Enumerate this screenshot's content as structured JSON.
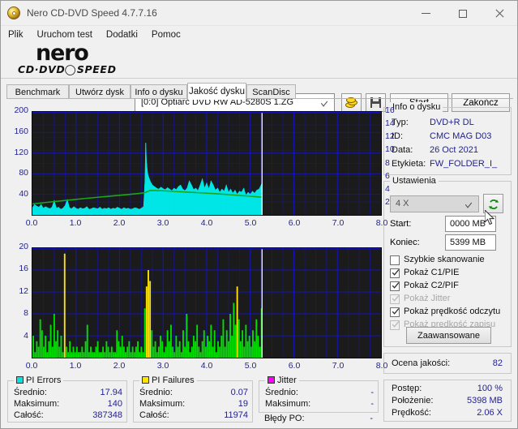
{
  "window": {
    "title": "Nero CD-DVD Speed 4.7.7.16",
    "icon": "nero-disc-icon",
    "controls": {
      "minimize": "minimize-icon",
      "maximize": "maximize-icon",
      "close": "close-icon"
    }
  },
  "menu": {
    "items": [
      "Plik",
      "Uruchom test",
      "Dodatki",
      "Pomoc"
    ]
  },
  "brand": {
    "name": "nero",
    "sub_left": "CD·DVD",
    "sub_right": "SPEED"
  },
  "toolbar": {
    "drive": "[0:0]   Optiarc DVD RW AD-5280S 1.ZG",
    "drive_caret": "chevron-down-icon",
    "disc_button_icon": "disc-coins-icon",
    "save_button_icon": "floppy-save-icon",
    "start_label": "Start",
    "exit_label": "Zakończ"
  },
  "tabs": [
    {
      "label": "Benchmark",
      "active": false
    },
    {
      "label": "Utwórz dysk",
      "active": false
    },
    {
      "label": "Info o dysku",
      "active": false
    },
    {
      "label": "Jakość dysku",
      "active": true
    },
    {
      "label": "ScanDisc",
      "active": false
    }
  ],
  "disc_info": {
    "legend": "Info o dysku",
    "rows": [
      {
        "key": "Typ:",
        "value": "DVD+R DL"
      },
      {
        "key": "ID:",
        "value": "CMC MAG D03"
      },
      {
        "key": "Data:",
        "value": "26 Oct 2021"
      },
      {
        "key": "Etykieta:",
        "value": "FW_FOLDER_I_"
      }
    ]
  },
  "settings": {
    "legend": "Ustawienia",
    "speed_value": "4 X",
    "speed_caret": "chevron-down-icon",
    "refresh_icon": "refresh-icon",
    "start_label": "Start:",
    "start_value": "0000 MB",
    "end_label": "Koniec:",
    "end_value": "5399 MB",
    "checkboxes": [
      {
        "label": "Szybkie skanowanie",
        "checked": false,
        "disabled": false
      },
      {
        "label": "Pokaż C1/PIE",
        "checked": true,
        "disabled": false
      },
      {
        "label": "Pokaż C2/PIF",
        "checked": true,
        "disabled": false
      },
      {
        "label": "Pokaż Jitter",
        "checked": true,
        "disabled": true
      },
      {
        "label": "Pokaż prędkość odczytu",
        "checked": true,
        "disabled": false
      },
      {
        "label": "Pokaż prędkość zapisu",
        "checked": true,
        "disabled": true
      }
    ],
    "advanced_label": "Zaawansowane"
  },
  "quality": {
    "label": "Ocena jakości:",
    "value": "82"
  },
  "progress": {
    "rows": [
      {
        "key": "Postęp:",
        "value": "100 %"
      },
      {
        "key": "Położenie:",
        "value": "5398 MB"
      },
      {
        "key": "Prędkość:",
        "value": "2.06 X"
      }
    ]
  },
  "stats": {
    "pi_errors": {
      "legend": "PI Errors",
      "color": "#00e5e5",
      "rows": [
        {
          "key": "Średnio:",
          "value": "17.94"
        },
        {
          "key": "Maksimum:",
          "value": "140"
        },
        {
          "key": "Całość:",
          "value": "387348"
        }
      ]
    },
    "pi_failures": {
      "legend": "PI Failures",
      "color": "#ffe400",
      "rows": [
        {
          "key": "Średnio:",
          "value": "0.07"
        },
        {
          "key": "Maksimum:",
          "value": "19"
        },
        {
          "key": "Całość:",
          "value": "11974"
        }
      ]
    },
    "jitter": {
      "legend": "Jitter",
      "color": "#ff00ff",
      "rows": [
        {
          "key": "Średnio:",
          "value": "-"
        },
        {
          "key": "Maksimum:",
          "value": "-"
        }
      ]
    },
    "po_errors": {
      "key": "Błędy PO:",
      "value": "-"
    }
  },
  "chart_data": [
    {
      "id": "top",
      "type": "area",
      "title": "",
      "xlabel": "",
      "ylabel": "PI Errors",
      "xlim": [
        0.0,
        8.0
      ],
      "ylim": [
        0,
        200
      ],
      "y2lim": [
        0,
        16
      ],
      "xticks": [
        0.0,
        1.0,
        2.0,
        3.0,
        4.0,
        5.0,
        6.0,
        7.0,
        8.0
      ],
      "xticklabels": [
        "0.0",
        "1.0",
        "2.0",
        "3.0",
        "4.0",
        "5.0",
        "6.0",
        "7.0",
        "8.0"
      ],
      "yticks": [
        40,
        80,
        120,
        160,
        200
      ],
      "yticklabels": [
        "40",
        "80",
        "120",
        "160",
        "200"
      ],
      "y2ticks": [
        2,
        4,
        6,
        8,
        10,
        12,
        14,
        16
      ],
      "y2ticklabels": [
        "2",
        "4",
        "6",
        "8",
        "10",
        "12",
        "14",
        "16"
      ],
      "grid": true,
      "bg": "#1b1b1b",
      "grid_color": "#1414b4",
      "data_end_x": 5.27,
      "cursor_x": 5.27,
      "series": [
        {
          "name": "PI Errors",
          "color": "#00e5e5",
          "kind": "area",
          "x": [
            0.0,
            0.05,
            0.1,
            0.15,
            0.2,
            0.25,
            0.3,
            0.35,
            0.4,
            0.45,
            0.5,
            0.55,
            0.6,
            0.65,
            0.7,
            0.75,
            0.8,
            0.85,
            0.9,
            0.95,
            1.0,
            1.05,
            1.1,
            1.15,
            1.2,
            1.25,
            1.3,
            1.35,
            1.4,
            1.45,
            1.5,
            1.55,
            1.6,
            1.65,
            1.7,
            1.75,
            1.8,
            1.85,
            1.9,
            1.95,
            2.0,
            2.05,
            2.1,
            2.15,
            2.2,
            2.25,
            2.3,
            2.35,
            2.4,
            2.45,
            2.5,
            2.55,
            2.58,
            2.6,
            2.62,
            2.65,
            2.7,
            2.75,
            2.8,
            2.85,
            2.9,
            2.95,
            3.0,
            3.05,
            3.1,
            3.15,
            3.2,
            3.25,
            3.3,
            3.35,
            3.4,
            3.45,
            3.5,
            3.55,
            3.6,
            3.65,
            3.7,
            3.75,
            3.8,
            3.85,
            3.9,
            3.95,
            4.0,
            4.05,
            4.1,
            4.15,
            4.2,
            4.25,
            4.3,
            4.35,
            4.4,
            4.45,
            4.5,
            4.55,
            4.6,
            4.65,
            4.7,
            4.75,
            4.8,
            4.85,
            4.9,
            4.95,
            5.0,
            5.05,
            5.1,
            5.15,
            5.2,
            5.25,
            5.27
          ],
          "y": [
            14,
            20,
            17,
            15,
            20,
            13,
            16,
            14,
            12,
            15,
            28,
            13,
            15,
            11,
            13,
            18,
            30,
            14,
            12,
            16,
            13,
            11,
            14,
            12,
            13,
            16,
            11,
            12,
            14,
            13,
            12,
            15,
            11,
            13,
            12,
            14,
            11,
            13,
            12,
            15,
            13,
            11,
            14,
            12,
            13,
            11,
            12,
            14,
            13,
            11,
            13,
            16,
            60,
            140,
            100,
            78,
            66,
            58,
            55,
            52,
            50,
            54,
            51,
            49,
            53,
            50,
            47,
            52,
            49,
            55,
            58,
            50,
            47,
            52,
            66,
            58,
            49,
            52,
            47,
            58,
            70,
            52,
            62,
            50,
            66,
            58,
            48,
            52,
            44,
            50,
            46,
            58,
            44,
            50,
            42,
            48,
            40,
            46,
            44,
            52,
            38,
            44,
            40,
            46,
            42,
            48,
            50,
            58,
            62
          ]
        },
        {
          "name": "Read speed",
          "color": "#1aa81a",
          "kind": "line",
          "axis": "y2",
          "x": [
            0.0,
            0.4,
            0.8,
            1.2,
            1.6,
            2.0,
            2.4,
            2.58,
            2.7,
            3.0,
            3.4,
            3.8,
            4.2,
            4.6,
            5.0,
            5.27
          ],
          "y": [
            1.7,
            2.0,
            2.28,
            2.55,
            2.8,
            3.05,
            3.3,
            3.45,
            3.8,
            3.75,
            3.6,
            3.45,
            3.3,
            3.1,
            2.9,
            2.75
          ]
        }
      ]
    },
    {
      "id": "bottom",
      "type": "bar",
      "title": "",
      "xlabel": "",
      "ylabel": "PI Failures",
      "xlim": [
        0.0,
        8.0
      ],
      "ylim": [
        0,
        20
      ],
      "xticks": [
        0.0,
        1.0,
        2.0,
        3.0,
        4.0,
        5.0,
        6.0,
        7.0,
        8.0
      ],
      "xticklabels": [
        "0.0",
        "1.0",
        "2.0",
        "3.0",
        "4.0",
        "5.0",
        "6.0",
        "7.0",
        "8.0"
      ],
      "yticks": [
        4,
        8,
        12,
        16,
        20
      ],
      "yticklabels": [
        "4",
        "8",
        "12",
        "16",
        "20"
      ],
      "grid": true,
      "bg": "#1b1b1b",
      "grid_color": "#1414b4",
      "data_end_x": 5.27,
      "cursor_x": 5.27,
      "series": [
        {
          "name": "PI Failures",
          "color": "#00e000",
          "spike_color": "#ffe400",
          "kind": "bar",
          "x": [
            0.02,
            0.06,
            0.1,
            0.14,
            0.18,
            0.22,
            0.26,
            0.3,
            0.34,
            0.38,
            0.42,
            0.46,
            0.5,
            0.54,
            0.58,
            0.62,
            0.66,
            0.7,
            0.74,
            0.78,
            0.82,
            0.86,
            0.9,
            0.94,
            0.98,
            1.02,
            1.06,
            1.1,
            1.14,
            1.18,
            1.22,
            1.26,
            1.3,
            1.34,
            1.38,
            1.42,
            1.46,
            1.5,
            1.54,
            1.58,
            1.62,
            1.66,
            1.7,
            1.74,
            1.78,
            1.82,
            1.86,
            1.9,
            1.94,
            1.98,
            2.02,
            2.06,
            2.1,
            2.14,
            2.18,
            2.22,
            2.26,
            2.3,
            2.34,
            2.38,
            2.42,
            2.46,
            2.5,
            2.54,
            2.58,
            2.62,
            2.66,
            2.7,
            2.74,
            2.78,
            2.82,
            2.86,
            2.9,
            2.94,
            2.98,
            3.02,
            3.06,
            3.1,
            3.14,
            3.18,
            3.22,
            3.26,
            3.3,
            3.34,
            3.38,
            3.42,
            3.46,
            3.5,
            3.54,
            3.58,
            3.62,
            3.66,
            3.7,
            3.74,
            3.78,
            3.82,
            3.86,
            3.9,
            3.94,
            3.98,
            4.02,
            4.06,
            4.1,
            4.14,
            4.18,
            4.22,
            4.26,
            4.3,
            4.34,
            4.38,
            4.42,
            4.46,
            4.5,
            4.54,
            4.58,
            4.62,
            4.66,
            4.7,
            4.74,
            4.78,
            4.82,
            4.86,
            4.9,
            4.94,
            4.98,
            5.02,
            5.06,
            5.1,
            5.14,
            5.18,
            5.22,
            5.26
          ],
          "y": [
            4,
            1,
            3,
            2,
            7,
            5,
            2,
            4,
            1,
            3,
            6,
            2,
            8,
            3,
            5,
            2,
            4,
            1,
            19,
            2,
            1,
            3,
            1,
            2,
            1,
            2,
            1,
            1,
            2,
            1,
            3,
            6,
            1,
            2,
            1,
            1,
            2,
            3,
            1,
            1,
            2,
            1,
            3,
            2,
            1,
            2,
            1,
            1,
            5,
            3,
            2,
            4,
            2,
            1,
            2,
            3,
            1,
            2,
            1,
            2,
            3,
            1,
            2,
            1,
            9,
            13,
            16,
            14,
            5,
            2,
            3,
            1,
            2,
            4,
            3,
            1,
            2,
            5,
            3,
            6,
            2,
            1,
            4,
            2,
            3,
            1,
            5,
            2,
            8,
            3,
            1,
            2,
            4,
            3,
            6,
            2,
            1,
            3,
            5,
            2,
            4,
            3,
            6,
            2,
            5,
            1,
            3,
            2,
            4,
            7,
            2,
            5,
            3,
            8,
            4,
            10,
            6,
            13,
            7,
            3,
            5,
            2,
            6,
            3,
            4,
            2,
            5,
            3,
            7,
            4,
            2,
            9
          ]
        }
      ]
    }
  ]
}
